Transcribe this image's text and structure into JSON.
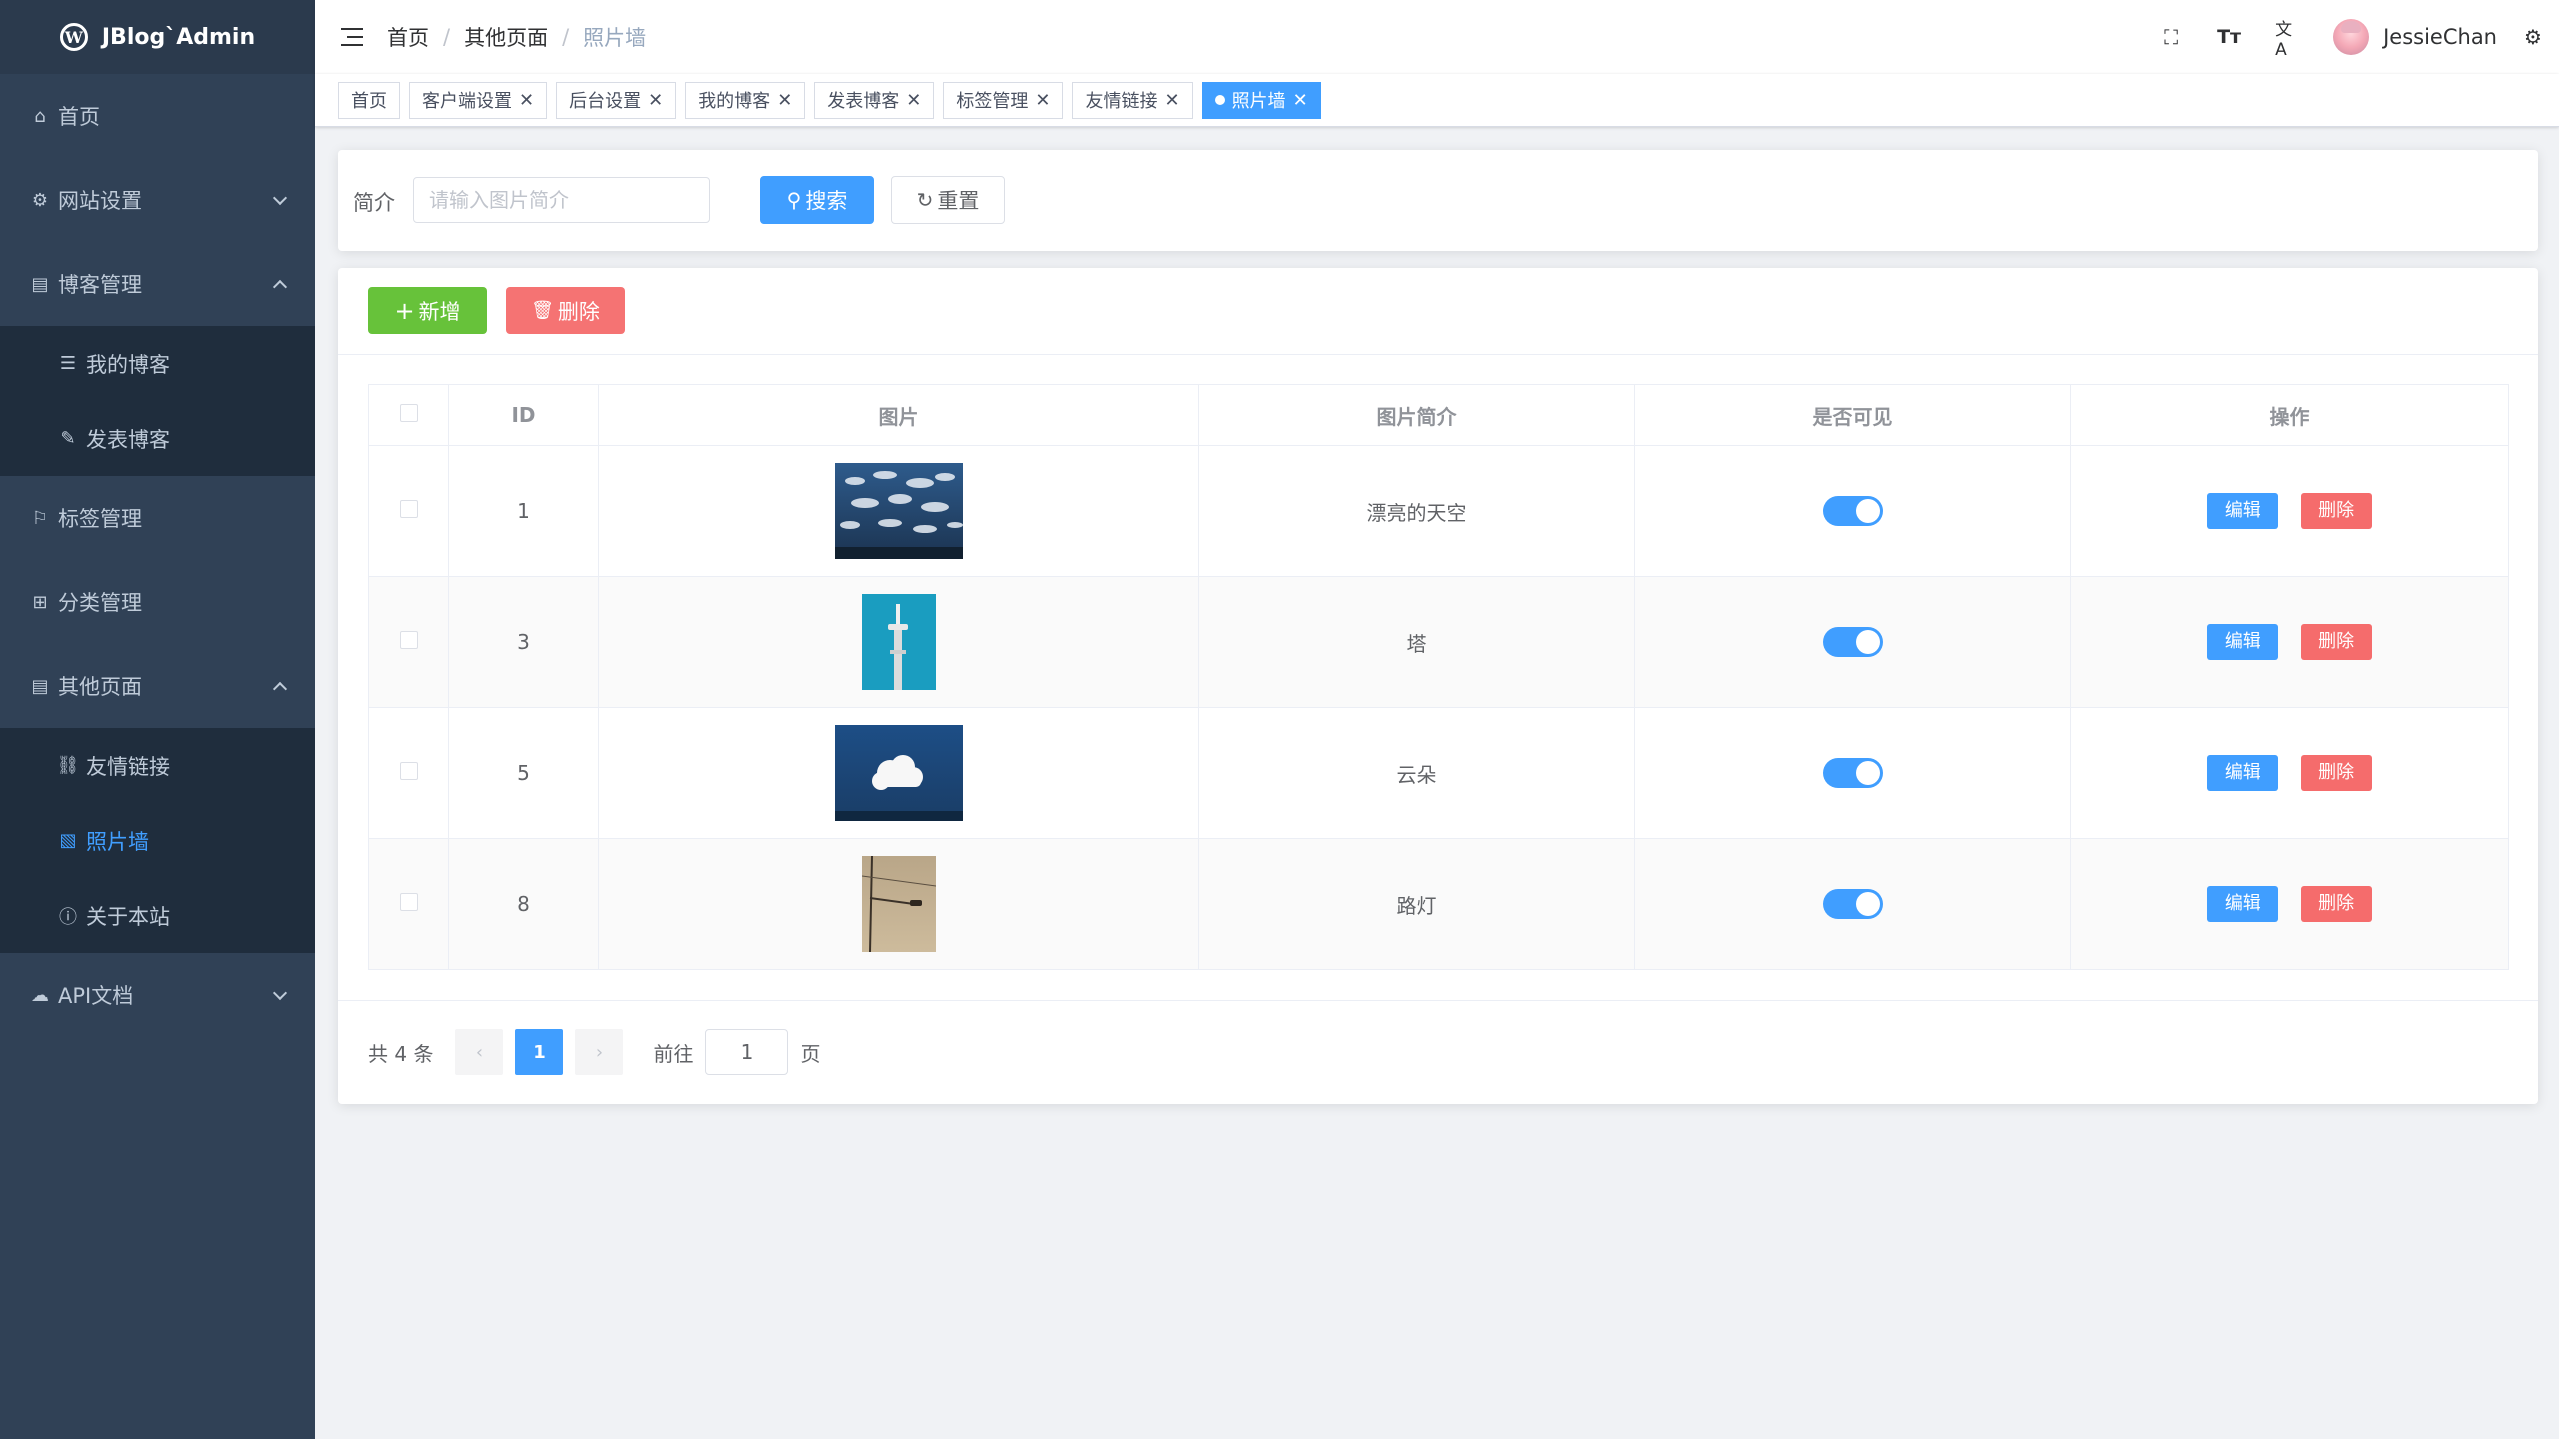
{
  "app": {
    "title": "JBlog`Admin"
  },
  "sidebar": {
    "items": [
      {
        "label": "首页",
        "icon": "home-icon"
      },
      {
        "label": "网站设置",
        "icon": "gear-icon"
      },
      {
        "label": "博客管理",
        "icon": "document-icon"
      },
      {
        "label": "我的博客",
        "icon": "list-icon"
      },
      {
        "label": "发表博客",
        "icon": "edit-icon"
      },
      {
        "label": "标签管理",
        "icon": "bookmark-icon"
      },
      {
        "label": "分类管理",
        "icon": "grid-icon"
      },
      {
        "label": "其他页面",
        "icon": "document-icon"
      },
      {
        "label": "友情链接",
        "icon": "link-icon"
      },
      {
        "label": "照片墙",
        "icon": "picture-icon"
      },
      {
        "label": "关于本站",
        "icon": "info-icon"
      },
      {
        "label": "API文档",
        "icon": "cloud-icon"
      }
    ],
    "active_color": "#409eff",
    "background": "#304156"
  },
  "navbar": {
    "breadcrumb": [
      "首页",
      "其他页面",
      "照片墙"
    ],
    "username": "JessieChan"
  },
  "tags": [
    "首页",
    "客户端设置",
    "后台设置",
    "我的博客",
    "发表博客",
    "标签管理",
    "友情链接",
    "照片墙"
  ],
  "search": {
    "label": "简介",
    "placeholder": "请输入图片简介",
    "search_button": "搜索",
    "reset_button": "重置"
  },
  "toolbar": {
    "add_label": "新增",
    "delete_label": "删除"
  },
  "table": {
    "headers": [
      "ID",
      "图片",
      "图片简介",
      "是否可见",
      "操作"
    ],
    "rows": [
      {
        "id": "1",
        "desc": "漂亮的天空",
        "visible": true,
        "thumb": "sky-photo"
      },
      {
        "id": "3",
        "desc": "塔",
        "visible": true,
        "thumb": "tower-photo"
      },
      {
        "id": "5",
        "desc": "云朵",
        "visible": true,
        "thumb": "cloud-photo"
      },
      {
        "id": "8",
        "desc": "路灯",
        "visible": true,
        "thumb": "streetlight-photo"
      }
    ],
    "edit_label": "编辑",
    "delete_label": "删除"
  },
  "pagination": {
    "total_text": "共 4 条",
    "current_page": "1",
    "goto_label": "前往",
    "goto_value": "1",
    "page_suffix": "页"
  },
  "colors": {
    "primary": "#409eff",
    "success": "#67c23a",
    "danger": "#f56c6c",
    "tag_active": "#42b983"
  }
}
